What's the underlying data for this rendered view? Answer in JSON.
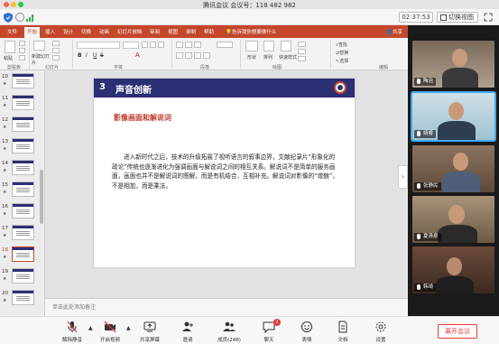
{
  "window": {
    "title": "腾讯会议 会议号：118 482 982"
  },
  "meeting_bar": {
    "timer": "02:37:53",
    "switch_view_label": "切换视图"
  },
  "ppt": {
    "tabs": [
      "文件",
      "开始",
      "插入",
      "设计",
      "切换",
      "动画",
      "幻灯片放映",
      "审阅",
      "视图",
      "录制",
      "帮助"
    ],
    "active_tab": "开始",
    "tell_me": "告诉我你想要做什么",
    "share_label": "共享",
    "ribbon": {
      "paste_label": "粘贴",
      "new_slide_label": "新建幻灯片",
      "groups": [
        "剪贴板",
        "幻灯片",
        "字体",
        "段落",
        "绘图",
        "编辑"
      ],
      "shape_label": "形状",
      "arrange_label": "排列",
      "quick_styles_label": "快速样式",
      "find_label": "查找",
      "replace_label": "替换",
      "select_label": "选择"
    },
    "thumbnails": [
      "10",
      "11",
      "12",
      "13",
      "14",
      "15",
      "16",
      "17",
      "18",
      "19",
      "20"
    ],
    "selected_slide": "18",
    "slide": {
      "number": "3",
      "title": "声音创新",
      "subtitle": "影像画面和解说词",
      "body": "进入新时代之后，技术的升级拓展了视听语言的叙事边界，文献纪录片“形象化的政论”传统也逐渐进化为强调画面与解说词之间的相互关系。解说词不是简单的服务画面，画面也并不是解说词的图解，而是有机结合，互相补充。解说词对影像的“增魅”，不是相加，而是乘法。"
    },
    "notes_placeholder": "单击此处添加备注"
  },
  "participants": [
    {
      "name": "陶治",
      "speaking": false
    },
    {
      "name": "靖睿",
      "speaking": true
    },
    {
      "name": "张静民",
      "speaking": false
    },
    {
      "name": "夏清泉",
      "speaking": false
    },
    {
      "name": "韩琦",
      "speaking": false
    }
  ],
  "toolbar": {
    "mute": "解除静音",
    "video": "开启视频",
    "share": "共享屏幕",
    "invite": "邀请",
    "members": "成员(248)",
    "chat": "聊天",
    "chat_badge": "2",
    "reactions": "表情",
    "docs": "文档",
    "settings": "设置",
    "leave": "离开会议"
  },
  "colors": {
    "ribbon": "#c4472b",
    "slide_header": "#2b2f73",
    "subtitle": "#c0392b",
    "leave": "#e53935",
    "speaking": "#3fa9f5"
  }
}
